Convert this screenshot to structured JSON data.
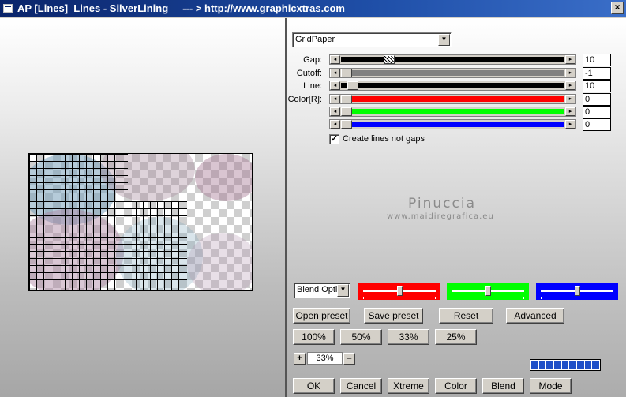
{
  "window": {
    "title": "AP [Lines]  Lines - SilverLining     --- > http://www.graphicxtras.com",
    "close_glyph": "×"
  },
  "controls": {
    "preset_dropdown": {
      "value": "GridPaper",
      "arrow_glyph": "▼"
    },
    "sliders": [
      {
        "label": "Gap:",
        "value": "10",
        "level": 0.2,
        "fill_color": "#000000",
        "hatched_thumb": true
      },
      {
        "label": "Cutoff:",
        "value": "-1",
        "level": 0.0,
        "fill_color": "#808080",
        "hatched_thumb": false
      },
      {
        "label": "Line:",
        "value": "10",
        "level": 0.03,
        "fill_color": "#000000",
        "hatched_thumb": false
      },
      {
        "label": "Color[R]:",
        "value": "0",
        "level": 0.0,
        "fill_color": "#ff0000",
        "hatched_thumb": false
      },
      {
        "label": "",
        "value": "0",
        "level": 0.0,
        "fill_color": "#00ff00",
        "hatched_thumb": false
      },
      {
        "label": "",
        "value": "0",
        "level": 0.0,
        "fill_color": "#0000ff",
        "hatched_thumb": false
      }
    ],
    "arrow_left_glyph": "◂",
    "arrow_right_glyph": "▸",
    "checkbox": {
      "label": "Create lines not gaps",
      "checked": true,
      "mark": "✓"
    }
  },
  "watermark": {
    "line1": "Pinuccia",
    "line2": "www.maidiregrafica.eu"
  },
  "blend": {
    "dropdown_value": "Blend Optio",
    "arrow_glyph": "▼",
    "color_sliders": [
      {
        "name": "red",
        "color": "#ff0000",
        "level": 0.5
      },
      {
        "name": "green",
        "color": "#00ff00",
        "level": 0.5
      },
      {
        "name": "blue",
        "color": "#0000ff",
        "level": 0.5
      }
    ]
  },
  "buttons": {
    "open_preset": "Open preset",
    "save_preset": "Save preset",
    "reset": "Reset",
    "advanced": "Advanced",
    "zoom_100": "100%",
    "zoom_50": "50%",
    "zoom_33": "33%",
    "zoom_25": "25%",
    "ok": "OK",
    "cancel": "Cancel",
    "xtreme": "Xtreme",
    "color": "Color",
    "blend": "Blend",
    "mode": "Mode"
  },
  "zoom": {
    "value": "33%",
    "plus": "+",
    "minus": "–"
  },
  "progress": {
    "fraction": 1.0,
    "segments": 9
  }
}
